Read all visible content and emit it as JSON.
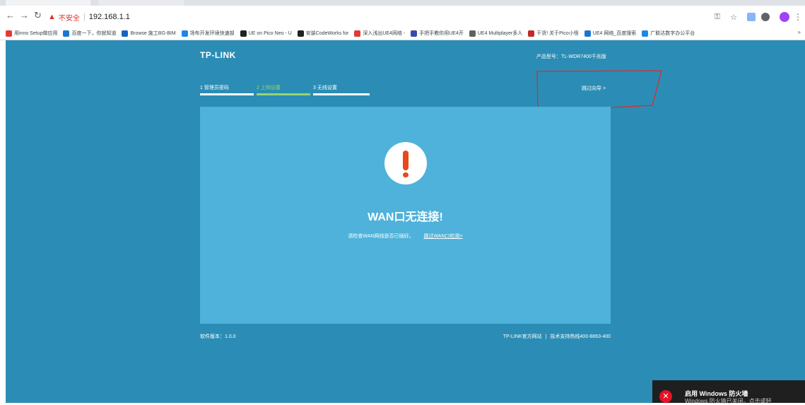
{
  "browser": {
    "url_warning": "不安全",
    "url": "192.168.1.1",
    "bookmarks": [
      {
        "label": "用inno Setup做应用",
        "color": "#e53935"
      },
      {
        "label": "百度一下，你就知道",
        "color": "#1976d2"
      },
      {
        "label": "Browse 施工BG-BIM",
        "color": "#1565c0"
      },
      {
        "label": "场布开发环境快速部",
        "color": "#1e88e5"
      },
      {
        "label": "UE on Pico Neo - U",
        "color": "#212121"
      },
      {
        "label": "安装CodeWorks for",
        "color": "#212121"
      },
      {
        "label": "深入浅出UE4网络 - ",
        "color": "#e53935"
      },
      {
        "label": "手把手教你用UE4开",
        "color": "#3949ab"
      },
      {
        "label": "UE4 Multiplayer多人",
        "color": "#616161"
      },
      {
        "label": "干货! 关于Pico小怪",
        "color": "#c62828"
      },
      {
        "label": "UE4 网络_百度搜索",
        "color": "#1976d2"
      },
      {
        "label": "广联达数字办公平台",
        "color": "#1e88e5"
      }
    ]
  },
  "header": {
    "logo": "TP-LINK",
    "model": "产品型号：TL-WDR7400千兆版"
  },
  "steps": [
    {
      "label": "1 管理员密码"
    },
    {
      "label": "2 上网设置"
    },
    {
      "label": "3 无线设置"
    }
  ],
  "skip_label": "跳过向导 >",
  "card": {
    "title": "WAN口无连接!",
    "message": "请检查WAN网线是否已插好。",
    "link": "跳过WAN口检测>"
  },
  "footer": {
    "version": "软件版本：1.0.0",
    "site": "TP-LINK官方网站",
    "hotline": "技术支持热线400-8863-400"
  },
  "toast": {
    "title": "启用 Windows 防火墙",
    "body": "Windows 防火墙已关闭。点击或轻"
  },
  "colors": {
    "page_bg": "#2b8db5",
    "card_bg": "#4eb2da",
    "active_step": "#94d66d",
    "alert_mark": "#e64a19",
    "annotation": "#d32f2f"
  }
}
